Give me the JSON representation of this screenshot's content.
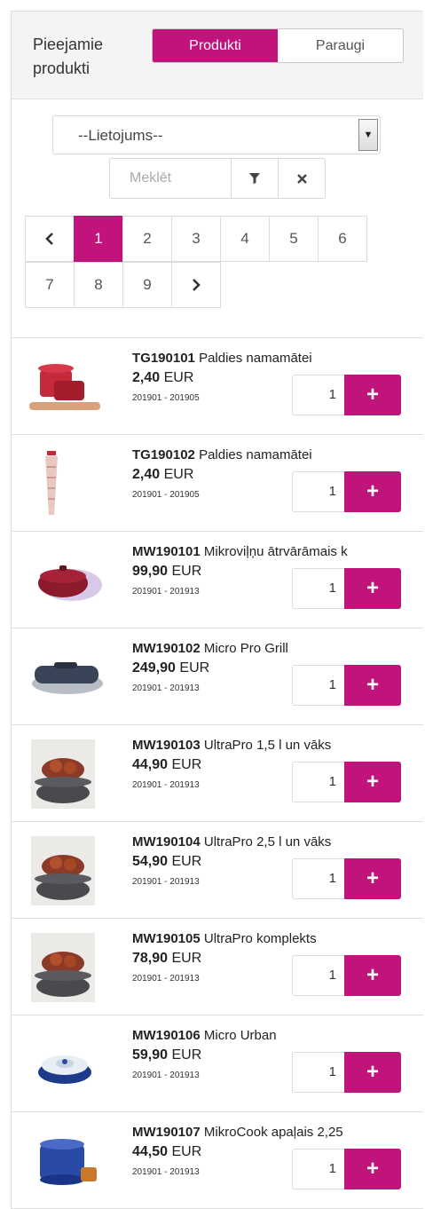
{
  "header": {
    "title": "Pieejamie produkti",
    "tab_products": "Produkti",
    "tab_samples": "Paraugi"
  },
  "filters": {
    "usage_select_value": "--Lietojums--",
    "search_placeholder": "Meklēt",
    "filter_icon": "filter-icon",
    "clear_icon": "close-icon"
  },
  "pagination": {
    "row1": [
      "1",
      "2",
      "3",
      "4",
      "5",
      "6"
    ],
    "row2": [
      "7",
      "8",
      "9"
    ],
    "current": "1"
  },
  "colors": {
    "accent": "#c0137c"
  },
  "products": [
    {
      "code": "TG190101",
      "name": "Paldies namamātei",
      "price": "2,40",
      "currency": "EUR",
      "period": "201901 - 201905",
      "qty": "1"
    },
    {
      "code": "TG190102",
      "name": "Paldies namamātei",
      "price": "2,40",
      "currency": "EUR",
      "period": "201901 - 201905",
      "qty": "1"
    },
    {
      "code": "MW190101",
      "name": "Mikroviļņu ātrvārāmais k",
      "price": "99,90",
      "currency": "EUR",
      "period": "201901 - 201913",
      "qty": "1"
    },
    {
      "code": "MW190102",
      "name": "Micro Pro Grill",
      "price": "249,90",
      "currency": "EUR",
      "period": "201901 - 201913",
      "qty": "1"
    },
    {
      "code": "MW190103",
      "name": "UltraPro 1,5 l un vāks",
      "price": "44,90",
      "currency": "EUR",
      "period": "201901 - 201913",
      "qty": "1"
    },
    {
      "code": "MW190104",
      "name": "UltraPro 2,5 l un vāks",
      "price": "54,90",
      "currency": "EUR",
      "period": "201901 - 201913",
      "qty": "1"
    },
    {
      "code": "MW190105",
      "name": "UltraPro komplekts",
      "price": "78,90",
      "currency": "EUR",
      "period": "201901 - 201913",
      "qty": "1"
    },
    {
      "code": "MW190106",
      "name": "Micro Urban",
      "price": "59,90",
      "currency": "EUR",
      "period": "201901 - 201913",
      "qty": "1"
    },
    {
      "code": "MW190107",
      "name": "MikroCook apaļais 2,25",
      "price": "44,50",
      "currency": "EUR",
      "period": "201901 - 201913",
      "qty": "1"
    }
  ]
}
